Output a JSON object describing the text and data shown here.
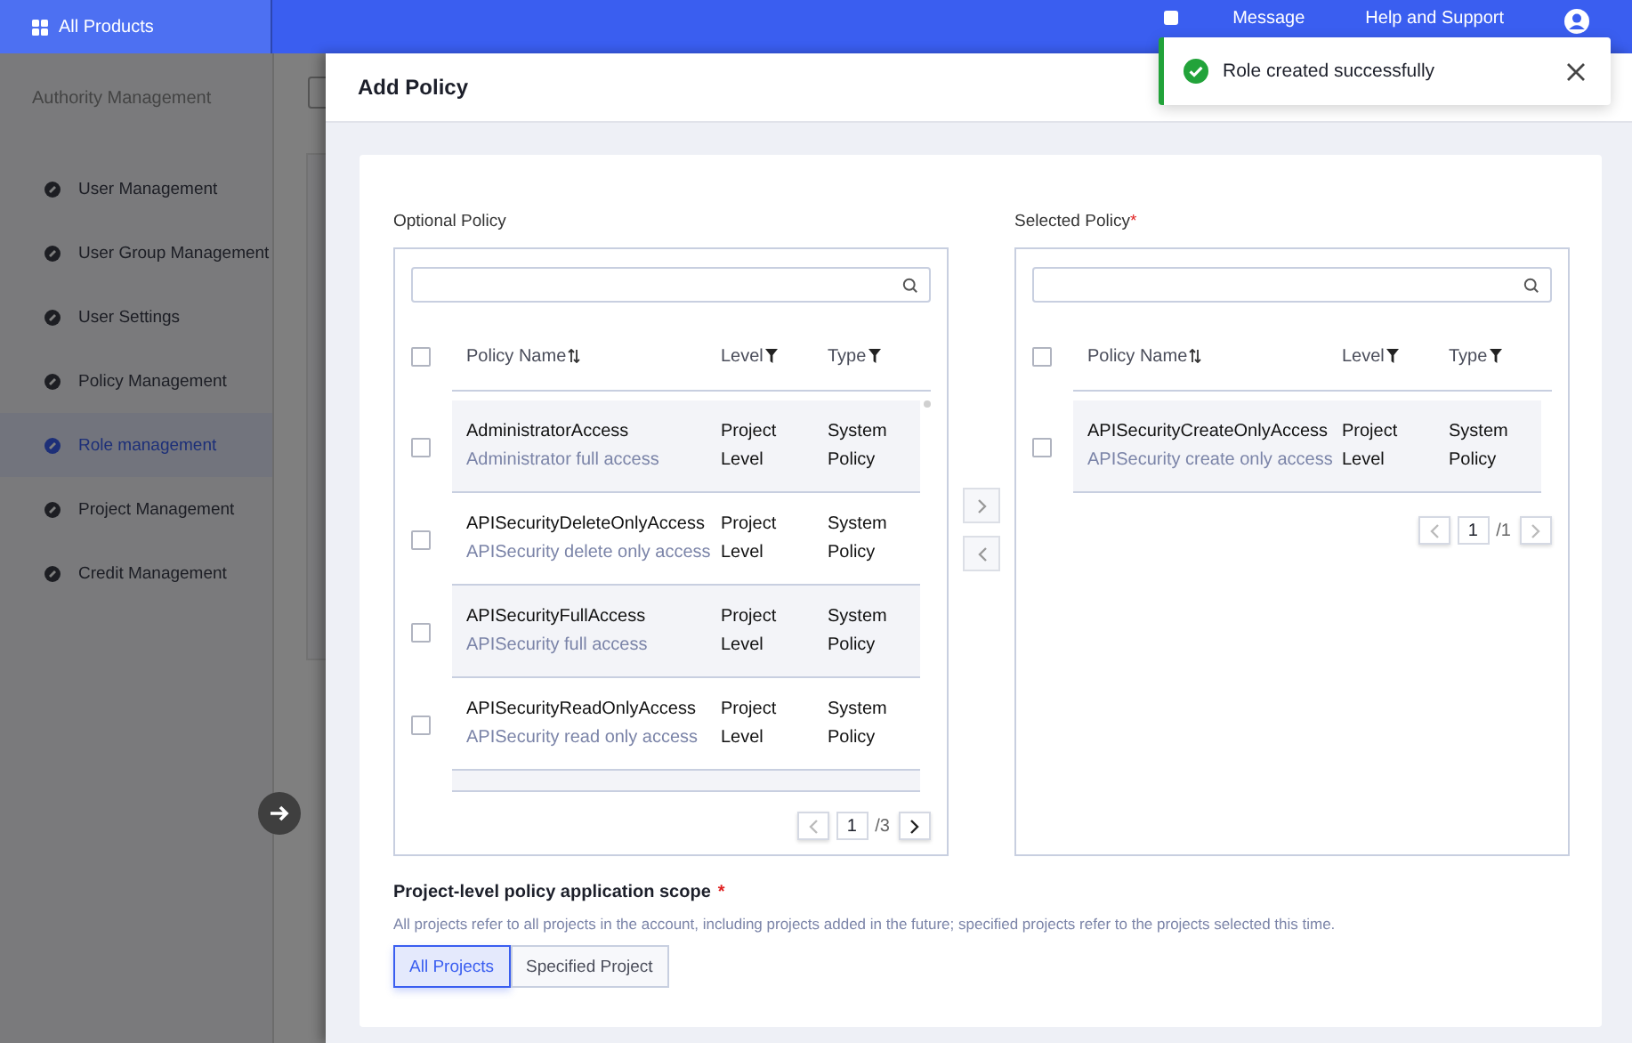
{
  "top_bar": {
    "products_label": "All Products",
    "links": [
      "Message",
      "Help and Support"
    ]
  },
  "sidebar": {
    "title": "Authority Management",
    "items": [
      {
        "label": "User Management",
        "selected": false
      },
      {
        "label": "User Group Management",
        "selected": false
      },
      {
        "label": "User Settings",
        "selected": false
      },
      {
        "label": "Policy Management",
        "selected": false
      },
      {
        "label": "Role management",
        "selected": true
      },
      {
        "label": "Project Management",
        "selected": false
      },
      {
        "label": "Credit Management",
        "selected": false
      }
    ]
  },
  "drawer": {
    "title": "Add Policy",
    "optional_policy": {
      "label": "Optional Policy",
      "select_all_checked": false,
      "columns": [
        "Policy Name",
        "Level",
        "Type"
      ],
      "rows": [
        {
          "name": "AdministratorAccess",
          "description": "Administrator full access",
          "level": "Project Level",
          "type": "System Policy",
          "checked": false
        },
        {
          "name": "APISecurityDeleteOnlyAccess",
          "description": "APISecurity delete only access",
          "level": "Project Level",
          "type": "System Policy",
          "checked": false
        },
        {
          "name": "APISecurityFullAccess",
          "description": "APISecurity full access",
          "level": "Project Level",
          "type": "System Policy",
          "checked": false
        },
        {
          "name": "APISecurityReadOnlyAccess",
          "description": "APISecurity read only access",
          "level": "Project Level",
          "type": "System Policy",
          "checked": false
        }
      ],
      "page": "1",
      "total": "/3"
    },
    "transfer_buttons": [
      {
        "kind": "add",
        "disabled": true
      },
      {
        "kind": "remove",
        "disabled": true
      }
    ],
    "selected_policy": {
      "label": "Selected Policy",
      "required_mark": "*",
      "select_all_checked": false,
      "columns": [
        "Policy Name",
        "Level",
        "Type"
      ],
      "rows": [
        {
          "name": "APISecurityCreateOnlyAccess",
          "description": "APISecurity create only access",
          "level": "Project Level",
          "type": "System Policy",
          "checked": false
        }
      ],
      "page": "1",
      "total": "/1"
    },
    "scope": {
      "title": "Project-level policy application scope",
      "required_mark": "*",
      "description": "All projects refer to all projects in the account, including projects added in the future; specified projects refer to the projects selected this time.",
      "options": [
        {
          "label": "All Projects",
          "selected": true
        },
        {
          "label": "Specified Project",
          "selected": false
        }
      ]
    }
  },
  "toast": {
    "message": "Role created successfully"
  }
}
